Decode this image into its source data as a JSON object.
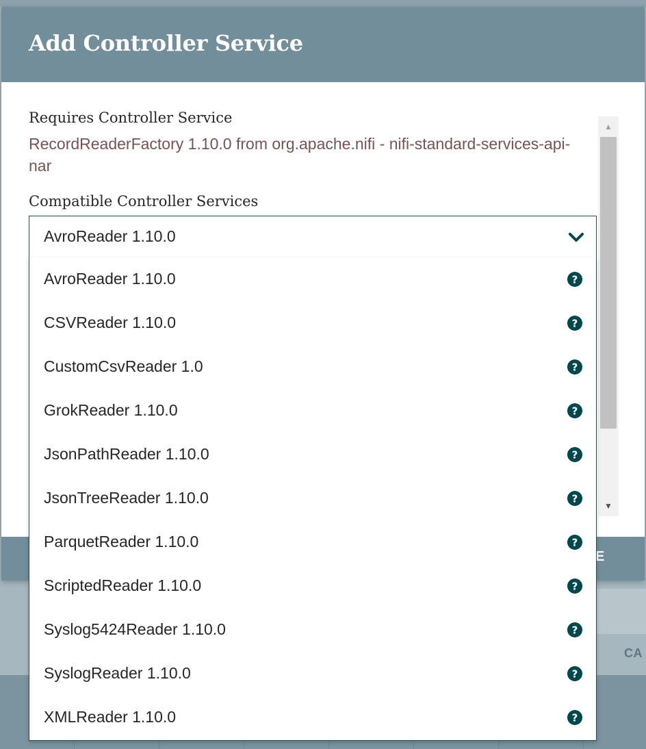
{
  "dialog": {
    "title": "Add Controller Service",
    "requires_label": "Requires Controller Service",
    "requires_value": "RecordReaderFactory 1.10.0 from org.apache.nifi - nifi-standard-services-api-nar",
    "compatible_label": "Compatible Controller Services",
    "selected_service": "AvroReader 1.10.0",
    "footer_partial": "E"
  },
  "services": [
    {
      "label": "AvroReader 1.10.0",
      "icon": "help-icon"
    },
    {
      "label": "CSVReader 1.10.0",
      "icon": "help-icon"
    },
    {
      "label": "CustomCsvReader 1.0",
      "icon": "help-icon"
    },
    {
      "label": "GrokReader 1.10.0",
      "icon": "help-icon"
    },
    {
      "label": "JsonPathReader 1.10.0",
      "icon": "help-icon"
    },
    {
      "label": "JsonTreeReader 1.10.0",
      "icon": "help-icon"
    },
    {
      "label": "ParquetReader 1.10.0",
      "icon": "help-icon"
    },
    {
      "label": "ScriptedReader 1.10.0",
      "icon": "help-icon"
    },
    {
      "label": "Syslog5424Reader 1.10.0",
      "icon": "help-icon"
    },
    {
      "label": "SyslogReader 1.10.0",
      "icon": "help-icon"
    },
    {
      "label": "XMLReader 1.10.0",
      "icon": "help-icon"
    }
  ],
  "background": {
    "cancel_partial": "CA"
  },
  "colors": {
    "header": "#728e9b",
    "accent_text": "#775351",
    "combo_border": "#1f5055",
    "icon": "#004849"
  }
}
